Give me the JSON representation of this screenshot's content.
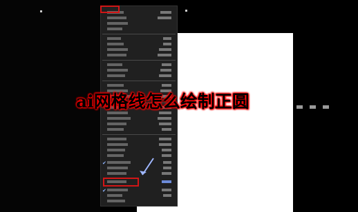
{
  "overlay": {
    "title": "ai网格线怎么绘制正圆"
  },
  "menu": {
    "rows": 30,
    "checked_rows": [
      27,
      32
    ],
    "highlighted_row": 31
  },
  "colors": {
    "accent": "#d21616",
    "menu_bg": "#202020",
    "canvas": "#ffffff"
  }
}
